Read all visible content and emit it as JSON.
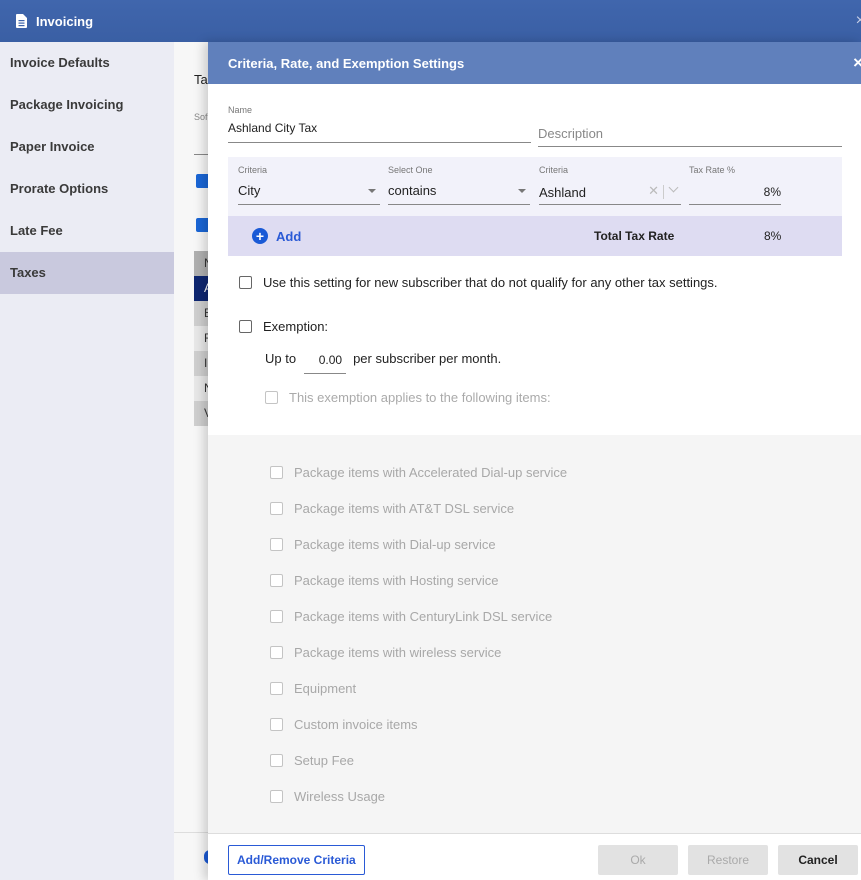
{
  "app": {
    "title": "Invoicing",
    "icon": "document-icon",
    "close_icon": "×"
  },
  "sidebar": {
    "items": [
      {
        "label": "Invoice Defaults",
        "active": false
      },
      {
        "label": "Package Invoicing",
        "active": false
      },
      {
        "label": "Paper Invoice",
        "active": false
      },
      {
        "label": "Prorate Options",
        "active": false
      },
      {
        "label": "Late Fee",
        "active": false
      },
      {
        "label": "Taxes",
        "active": true
      }
    ]
  },
  "background_page": {
    "title_fragment": "Ta",
    "label_fragment": "Sof",
    "row_fragments": [
      "N",
      "A",
      "E",
      "F",
      "I",
      "N",
      "V"
    ]
  },
  "modal": {
    "title": "Criteria, Rate, and Exemption Settings",
    "close_icon": "×",
    "name_label": "Name",
    "name_value": "Ashland City Tax",
    "description_placeholder": "Description",
    "criteria_row": {
      "criteria_label": "Criteria",
      "criteria_value": "City",
      "operator_label": "Select One",
      "operator_value": "contains",
      "criteria_value_label": "Criteria",
      "criteria_value_value": "Ashland",
      "tax_rate_label": "Tax Rate %",
      "tax_rate_value": "8%"
    },
    "add_label": "Add",
    "total_tax_rate_label": "Total Tax Rate",
    "total_tax_rate_value": "8%",
    "default_setting_label": "Use this setting for new subscriber that do not qualify for any other tax settings.",
    "default_setting_checked": false,
    "exemption_label": "Exemption:",
    "exemption_checked": false,
    "up_to_label": "Up to",
    "up_to_amount": "0.00",
    "up_to_suffix": "per subscriber per month.",
    "applies_label": "This exemption applies to the following items:",
    "applies_checked": false,
    "items": [
      {
        "label": "Package items with Accelerated Dial-up service",
        "checked": false
      },
      {
        "label": "Package items with AT&T DSL service",
        "checked": false
      },
      {
        "label": "Package items with Dial-up service",
        "checked": false
      },
      {
        "label": "Package items with Hosting service",
        "checked": false
      },
      {
        "label": "Package items with CenturyLink DSL service",
        "checked": false
      },
      {
        "label": "Package items with wireless service",
        "checked": false
      },
      {
        "label": "Equipment",
        "checked": false
      },
      {
        "label": "Custom invoice items",
        "checked": false
      },
      {
        "label": "Setup Fee",
        "checked": false
      },
      {
        "label": "Wireless Usage",
        "checked": false
      }
    ],
    "footer": {
      "add_remove_label": "Add/Remove Criteria",
      "ok_label": "Ok",
      "restore_label": "Restore",
      "cancel_label": "Cancel"
    }
  },
  "colors": {
    "app_bar": "#3d63aa",
    "modal_header": "#6080bc",
    "accent": "#2a5ad6",
    "sidebar_active": "#c9c9de",
    "add_row": "#dedcf2"
  }
}
